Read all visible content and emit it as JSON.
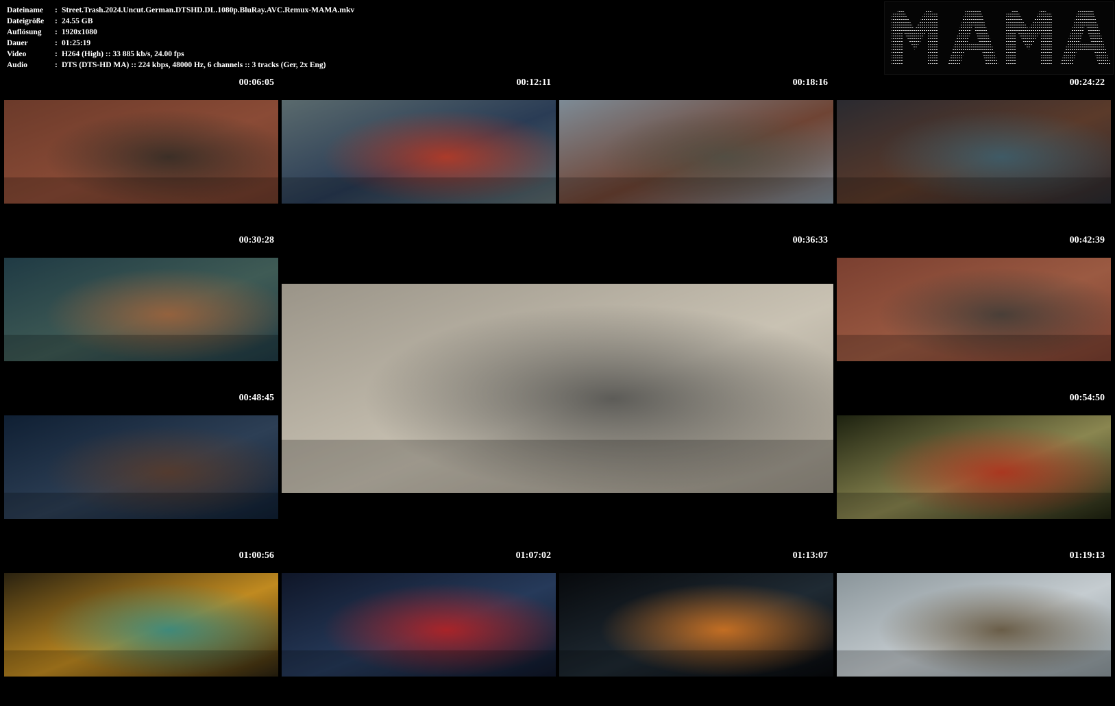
{
  "meta": [
    {
      "key": "Dateiname",
      "value": "Street.Trash.2024.Uncut.German.DTSHD.DL.1080p.BluRay.AVC.Remux-MAMA.mkv"
    },
    {
      "key": "Dateigröße",
      "value": "24.55 GB"
    },
    {
      "key": "Auflösung",
      "value": "1920x1080"
    },
    {
      "key": "Dauer",
      "value": "01:25:19"
    },
    {
      "key": "Video",
      "value": "H264 (High) :: 33 885 kb/s, 24.00 fps"
    },
    {
      "key": "Audio",
      "value": "DTS (DTS-HD MA) :: 224 kbps, 48000 Hz, 6 channels :: 3 tracks (Ger, 2x Eng)"
    }
  ],
  "separator": ":",
  "logo": {
    "text": "MAMA"
  },
  "thumbnails": [
    {
      "time": "00:06:05",
      "colors": [
        "#6b3a2a",
        "#8a4b36",
        "#2e2a24"
      ]
    },
    {
      "time": "00:12:11",
      "colors": [
        "#5a6a6d",
        "#2a3c55",
        "#c23a22"
      ]
    },
    {
      "time": "00:18:16",
      "colors": [
        "#7d8b96",
        "#6f4434",
        "#4d4f45"
      ]
    },
    {
      "time": "00:24:22",
      "colors": [
        "#2a2a30",
        "#5b3a2a",
        "#3a6070"
      ]
    },
    {
      "time": "00:30:28",
      "colors": [
        "#1f3a44",
        "#3f5b55",
        "#a3633a"
      ]
    },
    {
      "time": "00:36:33",
      "colors": [
        "#9a9488",
        "#c9c2b3",
        "#4a4a48"
      ]
    },
    {
      "time": "00:42:39",
      "colors": [
        "#7a3f30",
        "#9b5a42",
        "#3b3a36"
      ]
    },
    {
      "time": "00:48:45",
      "colors": [
        "#0f1f33",
        "#2d3f55",
        "#5a3a28"
      ]
    },
    {
      "time": "00:54:50",
      "colors": [
        "#1d2210",
        "#8a8650",
        "#b02a18"
      ]
    },
    {
      "time": "01:00:56",
      "colors": [
        "#2a2210",
        "#c08a20",
        "#2a8a8a"
      ]
    },
    {
      "time": "01:07:02",
      "colors": [
        "#0f1628",
        "#263a5a",
        "#c02020"
      ]
    },
    {
      "time": "01:13:07",
      "colors": [
        "#07090c",
        "#1f2a33",
        "#e07a20"
      ]
    },
    {
      "time": "01:19:13",
      "colors": [
        "#8a959a",
        "#c5ccd0",
        "#5a4a30"
      ]
    }
  ]
}
